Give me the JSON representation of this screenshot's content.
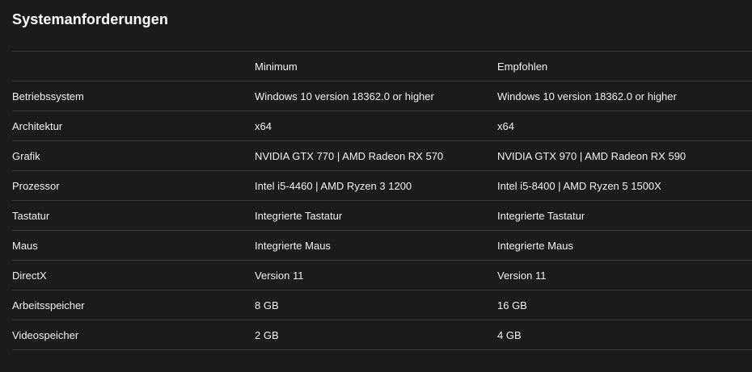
{
  "title": "Systemanforderungen",
  "columns": {
    "label": "",
    "minimum": "Minimum",
    "recommended": "Empfohlen"
  },
  "rows": [
    {
      "label": "Betriebssystem",
      "minimum": "Windows 10 version 18362.0 or higher",
      "recommended": "Windows 10 version 18362.0 or higher"
    },
    {
      "label": "Architektur",
      "minimum": "x64",
      "recommended": "x64"
    },
    {
      "label": "Grafik",
      "minimum": "NVIDIA GTX 770 | AMD Radeon RX 570",
      "recommended": "NVIDIA GTX 970 | AMD Radeon RX 590"
    },
    {
      "label": "Prozessor",
      "minimum": "Intel i5-4460 | AMD Ryzen 3 1200",
      "recommended": "Intel i5-8400 | AMD Ryzen 5 1500X"
    },
    {
      "label": "Tastatur",
      "minimum": "Integrierte Tastatur",
      "recommended": "Integrierte Tastatur"
    },
    {
      "label": "Maus",
      "minimum": "Integrierte Maus",
      "recommended": "Integrierte Maus"
    },
    {
      "label": "DirectX",
      "minimum": "Version 11",
      "recommended": "Version 11"
    },
    {
      "label": "Arbeitsspeicher",
      "minimum": "8 GB",
      "recommended": "16 GB"
    },
    {
      "label": "Videospeicher",
      "minimum": "2 GB",
      "recommended": "4 GB"
    }
  ]
}
